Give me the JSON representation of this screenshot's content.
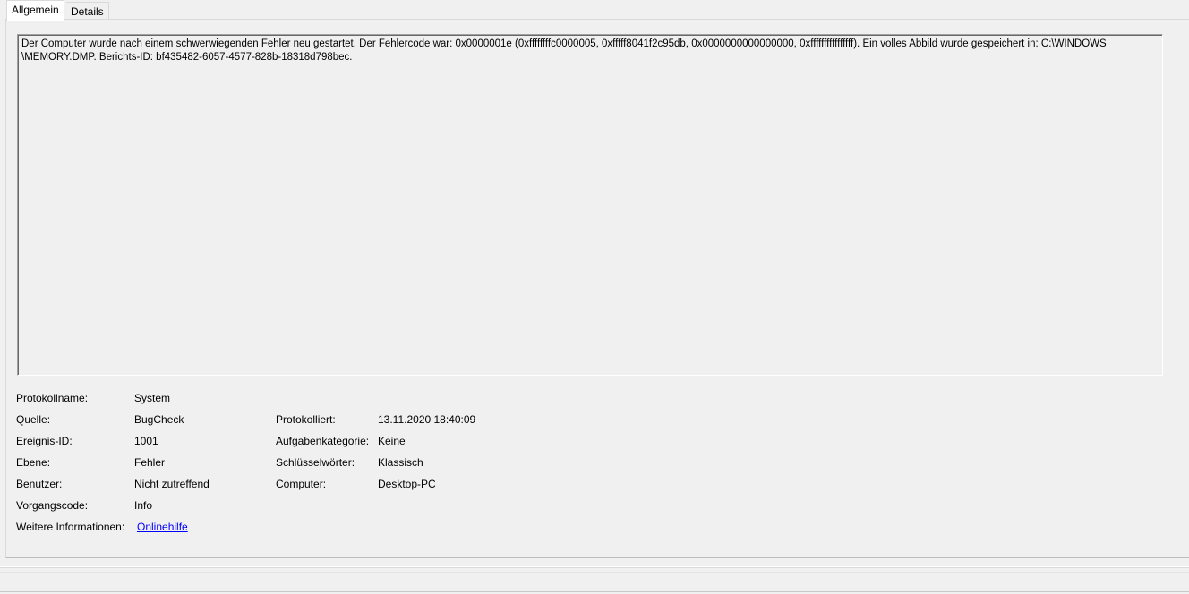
{
  "tabs": [
    {
      "label": "Allgemein",
      "active": true
    },
    {
      "label": "Details",
      "active": false
    }
  ],
  "description": "Der Computer wurde nach einem schwerwiegenden Fehler neu gestartet. Der Fehlercode war: 0x0000001e (0xffffffffc0000005, 0xfffff8041f2c95db, 0x0000000000000000, 0xffffffffffffffff). Ein volles Abbild wurde gespeichert in: C:\\WINDOWS\n\\MEMORY.DMP. Berichts-ID: bf435482-6057-4577-828b-18318d798bec.",
  "fields": {
    "log_name": {
      "label": "Protokollname:",
      "value": "System"
    },
    "source": {
      "label": "Quelle:",
      "value": "BugCheck"
    },
    "logged": {
      "label": "Protokolliert:",
      "value": "13.11.2020 18:40:09"
    },
    "event_id": {
      "label": "Ereignis-ID:",
      "value": "1001"
    },
    "task_category": {
      "label": "Aufgabenkategorie:",
      "value": "Keine"
    },
    "level": {
      "label": "Ebene:",
      "value": "Fehler"
    },
    "keywords": {
      "label": "Schlüsselwörter:",
      "value": "Klassisch"
    },
    "user": {
      "label": "Benutzer:",
      "value": "Nicht zutreffend"
    },
    "computer": {
      "label": "Computer:",
      "value": "Desktop-PC"
    },
    "opcode": {
      "label": "Vorgangscode:",
      "value": "Info"
    },
    "more_info": {
      "label": "Weitere Informationen:",
      "value": "Onlinehilfe"
    }
  },
  "colors": {
    "background": "#f0f0f0",
    "link": "#0000ff",
    "border": "#a0a0a0"
  }
}
